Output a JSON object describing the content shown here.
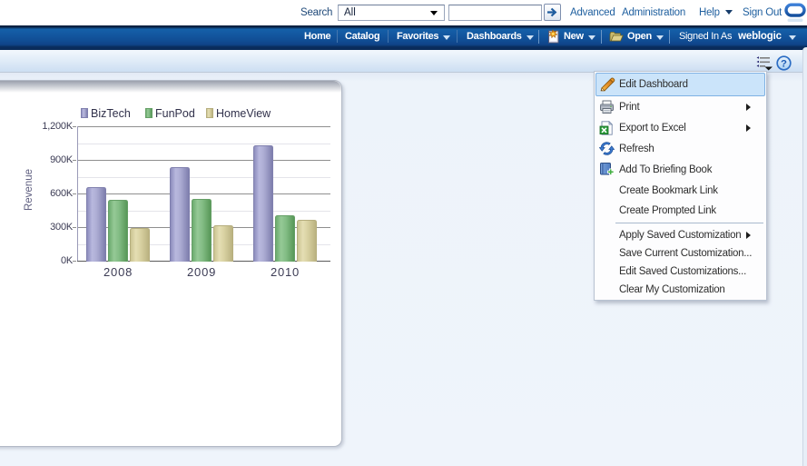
{
  "topbar": {
    "search_label": "Search",
    "search_scope_value": "All",
    "search_input_value": "",
    "advanced": "Advanced",
    "administration": "Administration",
    "help": "Help",
    "sign_out": "Sign Out",
    "logo_icon": "oracle-ring-logo",
    "go_icon": "go-arrow"
  },
  "navbar": {
    "home": "Home",
    "catalog": "Catalog",
    "favorites": "Favorites",
    "dashboards": "Dashboards",
    "new_label": "New",
    "open_label": "Open",
    "signed_in_label": "Signed In As",
    "user": "weblogic",
    "new_icon": "new-document-star",
    "open_icon": "open-folder"
  },
  "page_header": {
    "options_icon": "page-options-list",
    "help_icon": "help-question-circle"
  },
  "menu": {
    "items": [
      {
        "label": "Edit Dashboard",
        "icon": "pencil",
        "highlighted": true
      },
      {
        "label": "Print",
        "icon": "printer",
        "submenu": true
      },
      {
        "label": "Export to Excel",
        "icon": "excel",
        "submenu": true
      },
      {
        "label": "Refresh",
        "icon": "refresh"
      },
      {
        "label": "Add To Briefing Book",
        "icon": "briefing-book"
      },
      {
        "label": "Create Bookmark Link"
      },
      {
        "label": "Create Prompted Link"
      },
      {
        "label": "Apply Saved Customization",
        "submenu": true,
        "separator_before": true
      },
      {
        "label": "Save Current Customization..."
      },
      {
        "label": "Edit Saved Customizations..."
      },
      {
        "label": "Clear My Customization"
      }
    ]
  },
  "chart_data": {
    "type": "bar",
    "categories": [
      "2008",
      "2009",
      "2010"
    ],
    "series": [
      {
        "name": "BizTech",
        "values": [
          660,
          835,
          1030
        ],
        "color": "#9c9cc8"
      },
      {
        "name": "FunPod",
        "values": [
          545,
          555,
          405
        ],
        "color": "#7ab97c"
      },
      {
        "name": "HomeView",
        "values": [
          295,
          315,
          370
        ],
        "color": "#d6cf9e"
      }
    ],
    "unit": "K",
    "title": "",
    "xlabel": "",
    "ylabel": "Revenue",
    "ylim": [
      0,
      1200
    ],
    "ytick_step": 300,
    "yticks": [
      "0K",
      "300K",
      "600K",
      "900K",
      "1,200K"
    ],
    "minor_grid_step": 150,
    "grid": true,
    "legend_position": "top"
  }
}
